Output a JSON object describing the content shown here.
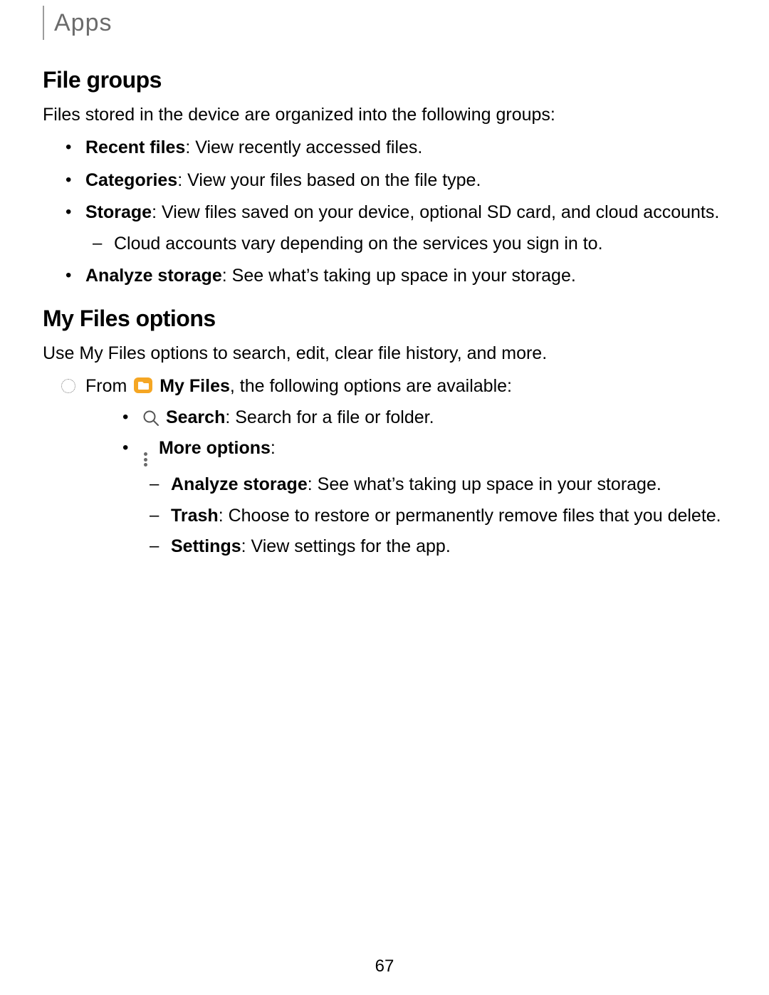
{
  "header": {
    "section": "Apps"
  },
  "section1": {
    "heading": "File groups",
    "intro": "Files stored in the device are organized into the following groups:",
    "items": [
      {
        "label": "Recent files",
        "text": ": View recently accessed files."
      },
      {
        "label": "Categories",
        "text": ": View your files based on the file type."
      },
      {
        "label": "Storage",
        "text": ": View files saved on your device, optional SD card, and cloud accounts.",
        "sub": [
          "Cloud accounts vary depending on the services you sign in to."
        ]
      },
      {
        "label": "Analyze storage",
        "text": ": See what’s taking up space in your storage."
      }
    ]
  },
  "section2": {
    "heading": "My Files options",
    "intro": "Use My Files options to search, edit, clear file history, and more.",
    "lead_prefix": "From ",
    "app_label": "My Files",
    "lead_suffix": ", the following options are available:",
    "options": [
      {
        "icon": "search",
        "label": "Search",
        "text": ": Search for a file or folder."
      },
      {
        "icon": "more",
        "label": "More options",
        "text": ":",
        "sub": [
          {
            "label": "Analyze storage",
            "text": ": See what’s taking up space in your storage."
          },
          {
            "label": "Trash",
            "text": ": Choose to restore or permanently remove files that you delete."
          },
          {
            "label": "Settings",
            "text": ": View settings for the app."
          }
        ]
      }
    ]
  },
  "page_number": "67"
}
